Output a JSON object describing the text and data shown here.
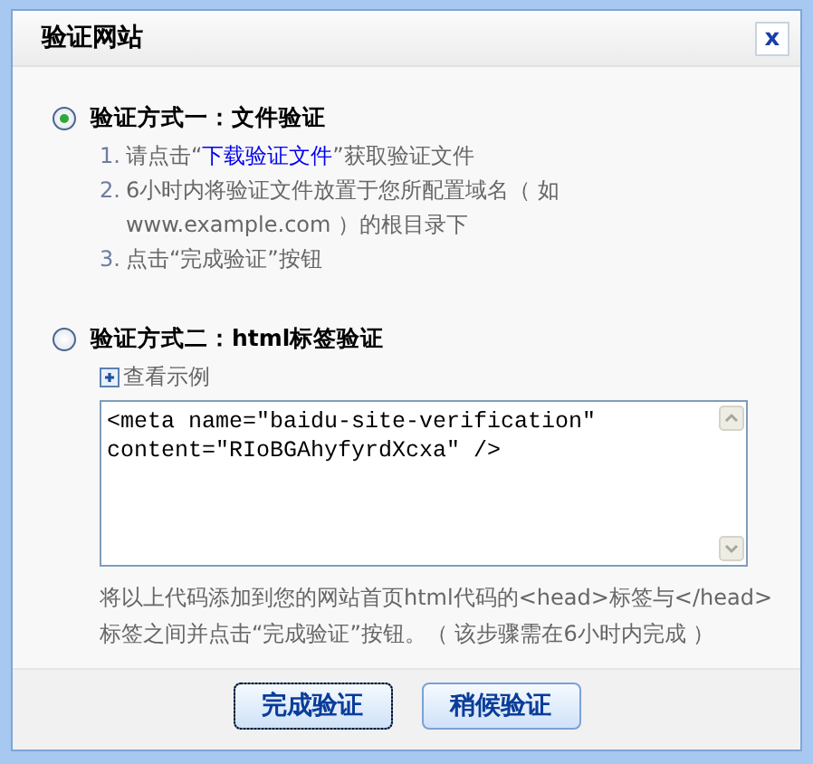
{
  "window": {
    "title": "验证网站",
    "close_label": "x"
  },
  "methods": [
    {
      "kind": "file",
      "selected": true,
      "title": "验证方式一：文件验证",
      "steps": [
        {
          "number": "1.",
          "before": "请点击“",
          "link": "下载验证文件",
          "after": "”获取验证文件"
        },
        {
          "number": "2.",
          "before": "6小时内将验证文件放置于您所配置域名（ 如www.example.com ）的根目录下"
        },
        {
          "number": "3.",
          "before": "点击“完成验证”按钮"
        }
      ]
    },
    {
      "kind": "html",
      "selected": false,
      "title": "验证方式二：html标签验证",
      "example_link": "查看示例",
      "code": "<meta name=\"baidu-site-verification\"\ncontent=\"RIoBGAhyfyrdXcxa\" />",
      "note": "将以上代码添加到您的网站首页html代码的<head>标签与</head>标签之间并点击“完成验证”按钮。（ 该步骤需在6小时内完成 ）"
    }
  ],
  "buttons": [
    {
      "label": "完成验证",
      "focused": true
    },
    {
      "label": "稍候验证",
      "focused": false
    }
  ]
}
